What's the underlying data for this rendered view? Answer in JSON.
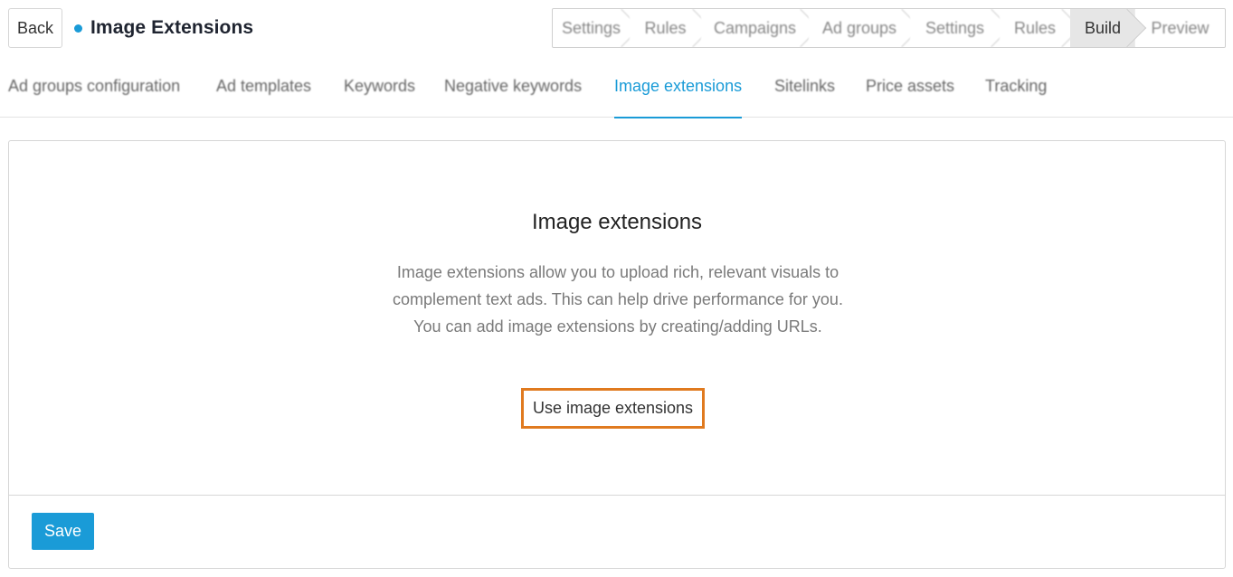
{
  "header": {
    "back_label": "Back",
    "title": "Image Extensions",
    "title_dot_color": "#1a9bd7"
  },
  "steps": [
    {
      "label": "Settings",
      "active": false
    },
    {
      "label": "Rules",
      "active": false
    },
    {
      "label": "Campaigns",
      "active": false
    },
    {
      "label": "Ad groups",
      "active": false
    },
    {
      "label": "Settings",
      "active": false
    },
    {
      "label": "Rules",
      "active": false
    },
    {
      "label": "Build",
      "active": true
    },
    {
      "label": "Preview",
      "active": false
    }
  ],
  "tabs": [
    {
      "label": "Ad groups configuration",
      "active": false
    },
    {
      "label": "Ad templates",
      "active": false
    },
    {
      "label": "Keywords",
      "active": false
    },
    {
      "label": "Negative keywords",
      "active": false
    },
    {
      "label": "Image extensions",
      "active": true
    },
    {
      "label": "Sitelinks",
      "active": false
    },
    {
      "label": "Price assets",
      "active": false
    },
    {
      "label": "Tracking",
      "active": false
    }
  ],
  "panel": {
    "heading": "Image extensions",
    "description": "Image extensions allow you to upload rich, relevant visuals to complement text ads. This can help drive performance for you. You can add image extensions by creating/adding URLs.",
    "use_button_label": "Use image extensions"
  },
  "footer": {
    "save_label": "Save"
  },
  "colors": {
    "accent": "#1a9bd7",
    "highlight": "#e07a1f"
  }
}
